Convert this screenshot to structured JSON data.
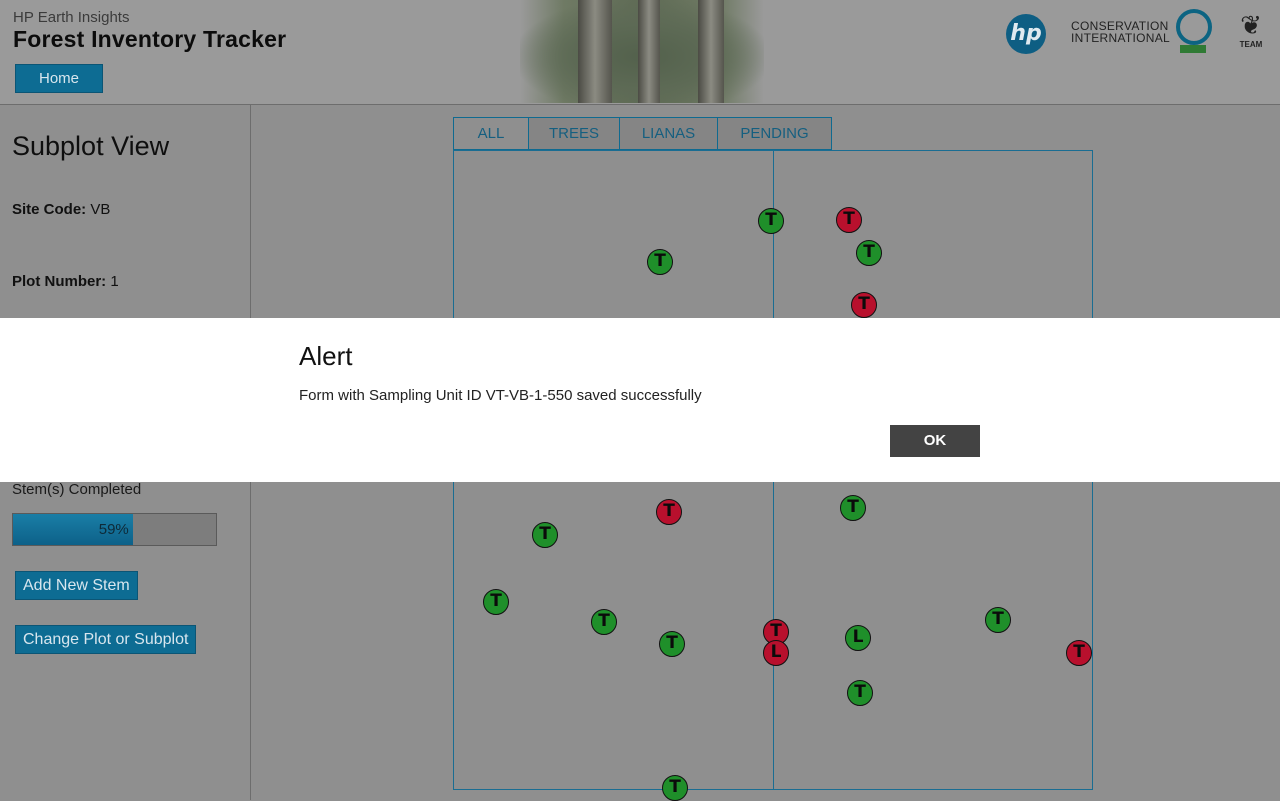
{
  "header": {
    "subtitle": "HP Earth Insights",
    "title": "Forest Inventory Tracker",
    "home_label": "Home",
    "logos": {
      "hp": "hp",
      "ci_line1": "CONSERVATION",
      "ci_line2": "INTERNATIONAL",
      "team": "TEAM"
    }
  },
  "left": {
    "title": "Subplot View",
    "site_code_label": "Site Code:",
    "site_code_value": "VB",
    "plot_number_label": "Plot Number:",
    "plot_number_value": "1",
    "stems_label": "Stem(s) Completed",
    "progress_percent": 59,
    "progress_text": "59%",
    "add_stem_label": "Add New Stem",
    "change_plot_label": "Change Plot or Subplot"
  },
  "tabs": [
    "ALL",
    "TREES",
    "LIANAS",
    "PENDING"
  ],
  "markers": [
    {
      "letter": "T",
      "status": "green"
    },
    {
      "letter": "T",
      "status": "red"
    },
    {
      "letter": "T",
      "status": "green"
    },
    {
      "letter": "T",
      "status": "green"
    },
    {
      "letter": "T",
      "status": "red"
    },
    {
      "letter": "T",
      "status": "green"
    },
    {
      "letter": "T",
      "status": "red"
    },
    {
      "letter": "T",
      "status": "green"
    },
    {
      "letter": "T",
      "status": "green"
    },
    {
      "letter": "T",
      "status": "green"
    },
    {
      "letter": "T",
      "status": "green"
    },
    {
      "letter": "T",
      "status": "red"
    },
    {
      "letter": "L",
      "status": "red"
    },
    {
      "letter": "L",
      "status": "green"
    },
    {
      "letter": "T",
      "status": "green"
    },
    {
      "letter": "T",
      "status": "red"
    },
    {
      "letter": "T",
      "status": "green"
    },
    {
      "letter": "T",
      "status": "green"
    }
  ],
  "alert": {
    "title": "Alert",
    "message": "Form with Sampling Unit ID VT-VB-1-550 saved successfully",
    "ok_label": "OK"
  },
  "colors": {
    "accent": "#0d6c93",
    "green_marker": "#1f8f2a",
    "red_marker": "#b8102d"
  }
}
